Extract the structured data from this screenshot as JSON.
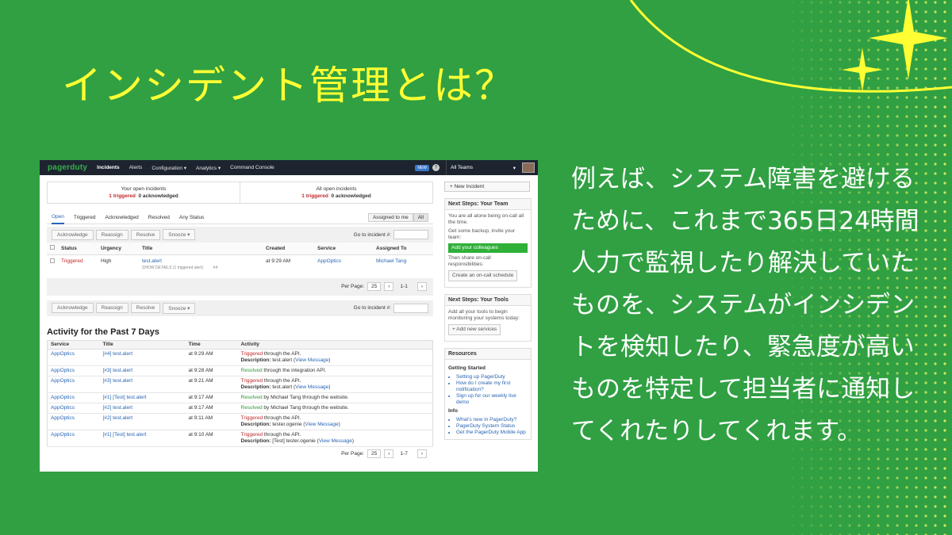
{
  "slide": {
    "title": "インシデント管理とは？",
    "body": "例えば、システム障害を避けるために、これまで365日24時間人力で監視したり解決していたものを、システムがインシデントを検知したり、緊急度が高いものを特定して担当者に通知してくれたりしてくれます。"
  },
  "colors": {
    "background": "#30a043",
    "title": "#ffff33",
    "body": "#ffffff",
    "accent": "#ffff33"
  },
  "app": {
    "logo": "pagerduty",
    "nav": [
      "Incidents",
      "Alerts",
      "Configuration ▾",
      "Analytics ▾",
      "Command Console"
    ],
    "new_badge": "NEW",
    "help_icon": "?",
    "team_select": "All Teams",
    "team_caret": "▾",
    "summary": {
      "mine_label": "Your open incidents",
      "mine_triggered": "1 triggered",
      "mine_ack": "0 acknowledged",
      "all_label": "All open incidents",
      "all_triggered": "1 triggered",
      "all_ack": "0 acknowledged"
    },
    "tabs": [
      "Open",
      "Triggered",
      "Acknowledged",
      "Resolved",
      "Any Status"
    ],
    "assign_options": [
      "Assigned to me",
      "All"
    ],
    "actions": [
      "Acknowledge",
      "Reassign",
      "Resolve",
      "Snooze ▾"
    ],
    "goto_label": "Go to incident #:",
    "columns": [
      "Status",
      "Urgency",
      "Title",
      "Created",
      "Service",
      "Assigned To"
    ],
    "incident": {
      "status": "Triggered",
      "urgency": "High",
      "title": "test.alert",
      "details": "SHOW DETAILS (1 triggered alert)",
      "number": "#4",
      "created": "at 9:29 AM",
      "service": "AppOptics",
      "assignee": "Michael Tang"
    },
    "pager": {
      "label": "Per Page:",
      "size": "25",
      "range": "1-1",
      "range_bottom": "1-7"
    },
    "activity_title": "Activity for the Past 7 Days",
    "activity_columns": [
      "Service",
      "Title",
      "Time",
      "Activity"
    ],
    "activity": [
      {
        "service": "AppOptics",
        "title": "[#4] test.alert",
        "time": "at 9:29 AM",
        "status": "Triggered",
        "text": " through the API.",
        "desc_label": "Description:",
        "desc": " test.alert (",
        "link": "View Message",
        "end": ")"
      },
      {
        "service": "AppOptics",
        "title": "[#3] test.alert",
        "time": "at 9:28 AM",
        "status": "Resolved",
        "text": " through the integration API.",
        "desc_label": "",
        "desc": "",
        "link": "",
        "end": ""
      },
      {
        "service": "AppOptics",
        "title": "[#3] test.alert",
        "time": "at 9:21 AM",
        "status": "Triggered",
        "text": " through the API.",
        "desc_label": "Description:",
        "desc": " test.alert (",
        "link": "View Message",
        "end": ")"
      },
      {
        "service": "AppOptics",
        "title": "[#1] [Test] test.alert",
        "time": "at 9:17 AM",
        "status": "Resolved",
        "text": " by Michael Tang through the website.",
        "desc_label": "",
        "desc": "",
        "link": "",
        "end": ""
      },
      {
        "service": "AppOptics",
        "title": "[#2] test.alert",
        "time": "at 9:17 AM",
        "status": "Resolved",
        "text": " by Michael Tang through the website.",
        "desc_label": "",
        "desc": "",
        "link": "",
        "end": ""
      },
      {
        "service": "AppOptics",
        "title": "[#2] test.alert",
        "time": "at 9:11 AM",
        "status": "Triggered",
        "text": " through the API.",
        "desc_label": "Description:",
        "desc": " tester.ogenie (",
        "link": "View Message",
        "end": ")"
      },
      {
        "service": "AppOptics",
        "title": "[#1] [Test] test.alert",
        "time": "at 9:10 AM",
        "status": "Triggered",
        "text": " through the API.",
        "desc_label": "Description:",
        "desc": " [Test] tester.ogenie (",
        "link": "View Message",
        "end": ")"
      }
    ],
    "sidebar": {
      "new_incident": "+ New Incident",
      "team_title": "Next Steps: Your Team",
      "team_alone": "You are all alone being on-call all the time.",
      "team_backup": "Get some backup, invite your team:",
      "team_btn": "Add your colleagues",
      "team_share": "Then share on-call responsibilities:",
      "team_schedule": "Create an on-call schedule",
      "tools_title": "Next Steps: Your Tools",
      "tools_text": "Add all your tools to begin monitoring your systems today:",
      "tools_btn": "+ Add new services",
      "res_title": "Resources",
      "res_gs": "Getting Started",
      "res_gs_items": [
        "Setting up PagerDuty",
        "How do I create my first notification?",
        "Sign up for our weekly live demo"
      ],
      "res_info": "Info",
      "res_info_items": [
        "What's new in PagerDuty?",
        "PagerDuty System Status",
        "Get the PagerDuty Mobile App"
      ]
    }
  }
}
